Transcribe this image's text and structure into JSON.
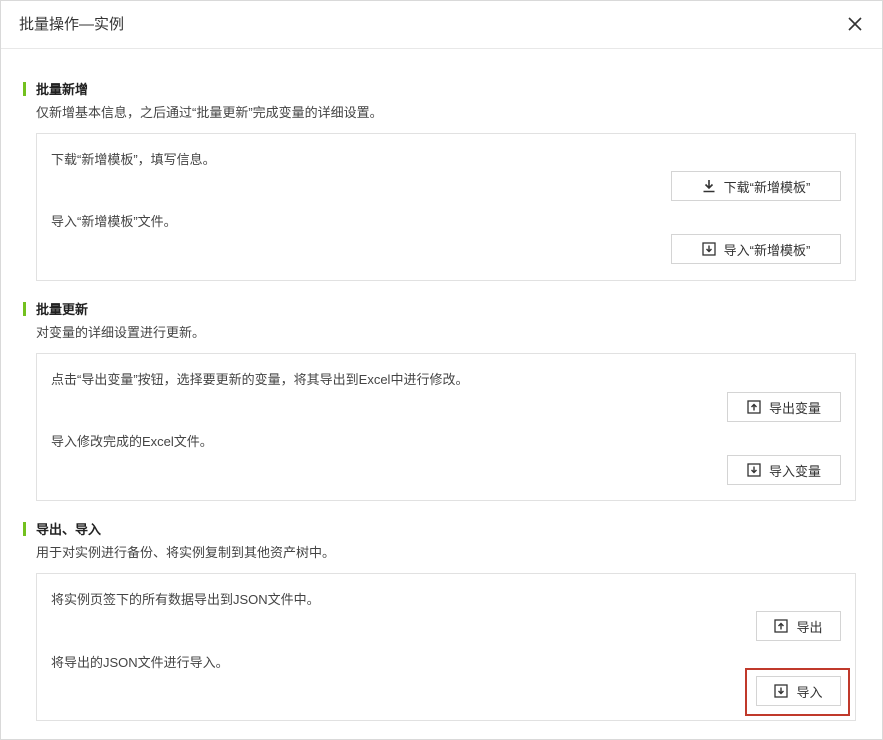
{
  "dialog": {
    "title": "批量操作—实例",
    "close_icon": "close-icon"
  },
  "sections": [
    {
      "title": "批量新增",
      "description": "仅新增基本信息，之后通过“批量更新”完成变量的详细设置。",
      "rows": [
        {
          "text": "下载“新增模板”，填写信息。",
          "button_label": "下载“新增模板”",
          "button_icon": "download-icon"
        },
        {
          "text": "导入“新增模板”文件。",
          "button_label": "导入“新增模板”",
          "button_icon": "import-icon"
        }
      ]
    },
    {
      "title": "批量更新",
      "description": "对变量的详细设置进行更新。",
      "rows": [
        {
          "text": "点击“导出变量”按钮，选择要更新的变量，将其导出到Excel中进行修改。",
          "button_label": "导出变量",
          "button_icon": "export-icon"
        },
        {
          "text": "导入修改完成的Excel文件。",
          "button_label": "导入变量",
          "button_icon": "import-icon"
        }
      ]
    },
    {
      "title": "导出、导入",
      "description": "用于对实例进行备份、将实例复制到其他资产树中。",
      "rows": [
        {
          "text": "将实例页签下的所有数据导出到JSON文件中。",
          "button_label": "导出",
          "button_icon": "export-icon"
        },
        {
          "text": "将导出的JSON文件进行导入。",
          "button_label": "导入",
          "button_icon": "import-icon"
        }
      ]
    }
  ],
  "colors": {
    "accent_bar": "#73c11f",
    "highlight_border": "#c0392b"
  }
}
